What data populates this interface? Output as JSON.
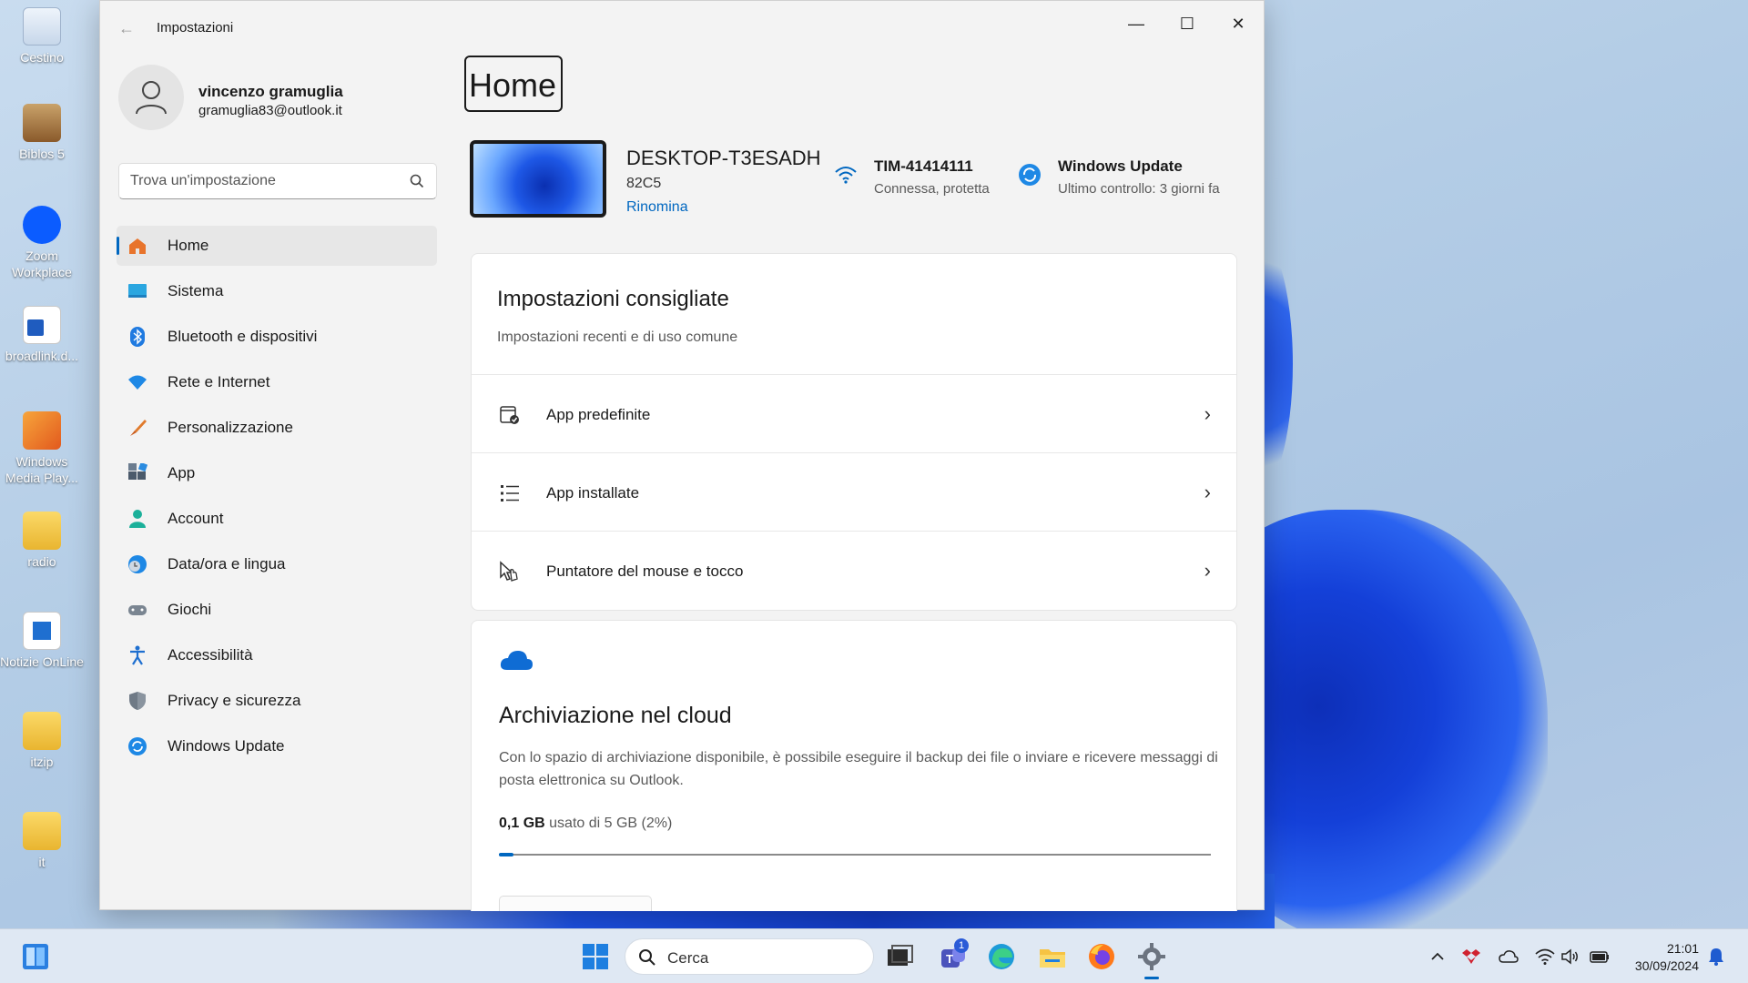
{
  "desktop": {
    "icons": [
      {
        "label": "Cestino"
      },
      {
        "label": "Biblos 5"
      },
      {
        "label": "Zoom Workplace"
      },
      {
        "label": "broadlink.d..."
      },
      {
        "label": "Windows Media Play..."
      },
      {
        "label": "radio"
      },
      {
        "label": "Notizie OnLine"
      },
      {
        "label": "itzip"
      },
      {
        "label": "it"
      }
    ]
  },
  "window": {
    "title": "Impostazioni",
    "controls": {
      "minimize": "—",
      "maximize": "☐",
      "close": "✕"
    }
  },
  "profile": {
    "name": "vincenzo gramuglia",
    "email": "gramuglia83@outlook.it"
  },
  "search": {
    "placeholder": "Trova un'impostazione"
  },
  "nav": {
    "items": [
      {
        "label": "Home",
        "icon": "home-icon",
        "active": true
      },
      {
        "label": "Sistema",
        "icon": "system-icon"
      },
      {
        "label": "Bluetooth e dispositivi",
        "icon": "bluetooth-icon"
      },
      {
        "label": "Rete e Internet",
        "icon": "network-icon"
      },
      {
        "label": "Personalizzazione",
        "icon": "brush-icon"
      },
      {
        "label": "App",
        "icon": "apps-icon"
      },
      {
        "label": "Account",
        "icon": "account-icon"
      },
      {
        "label": "Data/ora e lingua",
        "icon": "time-language-icon"
      },
      {
        "label": "Giochi",
        "icon": "gamepad-icon"
      },
      {
        "label": "Accessibilità",
        "icon": "accessibility-icon"
      },
      {
        "label": "Privacy e sicurezza",
        "icon": "shield-icon"
      },
      {
        "label": "Windows Update",
        "icon": "update-icon"
      }
    ]
  },
  "main": {
    "page_title": "Home",
    "device": {
      "name": "DESKTOP-T3ESADH",
      "model": "82C5",
      "rename": "Rinomina"
    },
    "network": {
      "name": "TIM-41414111",
      "status": "Connessa, protetta"
    },
    "update": {
      "title": "Windows Update",
      "status": "Ultimo controllo: 3 giorni fa"
    },
    "recommended": {
      "title": "Impostazioni consigliate",
      "subtitle": "Impostazioni recenti e di uso comune",
      "rows": [
        {
          "label": "App predefinite",
          "icon": "default-apps-icon"
        },
        {
          "label": "App installate",
          "icon": "installed-apps-icon"
        },
        {
          "label": "Puntatore del mouse e tocco",
          "icon": "mouse-pointer-icon"
        }
      ]
    },
    "cloud": {
      "title": "Archiviazione nel cloud",
      "description": "Con lo spazio di archiviazione disponibile, è possibile eseguire il backup dei file o inviare e ricevere messaggi di posta elettronica su Outlook.",
      "used": "0,1 GB",
      "usage_rest": "usato di 5 GB (2%)",
      "used_fraction": 0.02
    }
  },
  "taskbar": {
    "search_label": "Cerca",
    "teams_badge": "1",
    "time": "21:01",
    "date": "30/09/2024"
  },
  "colors": {
    "accent": "#0067c0",
    "window_bg": "#f3f3f3",
    "taskbar_bg": "#dfe8f3"
  }
}
